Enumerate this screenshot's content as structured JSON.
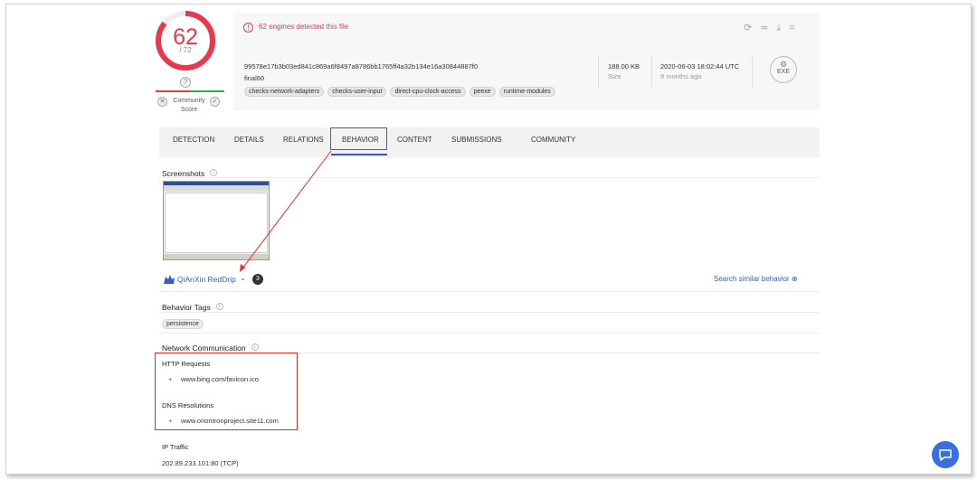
{
  "score": {
    "detected": "62",
    "total": "/ 72",
    "unknown_mark": "?",
    "community_label": "Community Score",
    "colors": {
      "ring_red": "#e8384f",
      "ring_track": "#eeeeee"
    }
  },
  "alert": {
    "text": "62 engines detected this file"
  },
  "file": {
    "hash": "99578e17b3b03ed841c869a6f8497a8786bb1765ff4a32b134e16a30844887f0",
    "name": "final60",
    "tags": [
      "checks-network-adapters",
      "checks-user-input",
      "direct-cpu-clock-access",
      "peexe",
      "runtime-modules"
    ],
    "size_value": "188.00 KB",
    "size_label": "Size",
    "date_value": "2020-06-03 18:02:44 UTC",
    "date_label": "9 months ago",
    "type": "EXE"
  },
  "tabs": [
    "DETECTION",
    "DETAILS",
    "RELATIONS",
    "BEHAVIOR",
    "CONTENT",
    "SUBMISSIONS",
    "COMMUNITY"
  ],
  "behavior": {
    "screenshots_label": "Screenshots",
    "sandbox_name": "QiAnXin RedDrip",
    "sandbox_count": "3",
    "search_similar": "Search similar behavior",
    "behavior_tags_label": "Behavior Tags",
    "behavior_tags": [
      "persistence"
    ],
    "network_label": "Network Communication",
    "http_label": "HTTP Requests",
    "http_requests": [
      "www.bing.com/favicon.ico"
    ],
    "dns_label": "DNS Resolutions",
    "dns_resolutions": [
      "www.oriontronproject.site11.com"
    ],
    "ip_label": "IP Traffic",
    "ip_traffic": [
      "202.89.233.101:80 (TCP)"
    ]
  },
  "accent": {
    "link": "#2f5ec4",
    "highlight": "#e82828",
    "active_tab": "#3b4ed6"
  }
}
